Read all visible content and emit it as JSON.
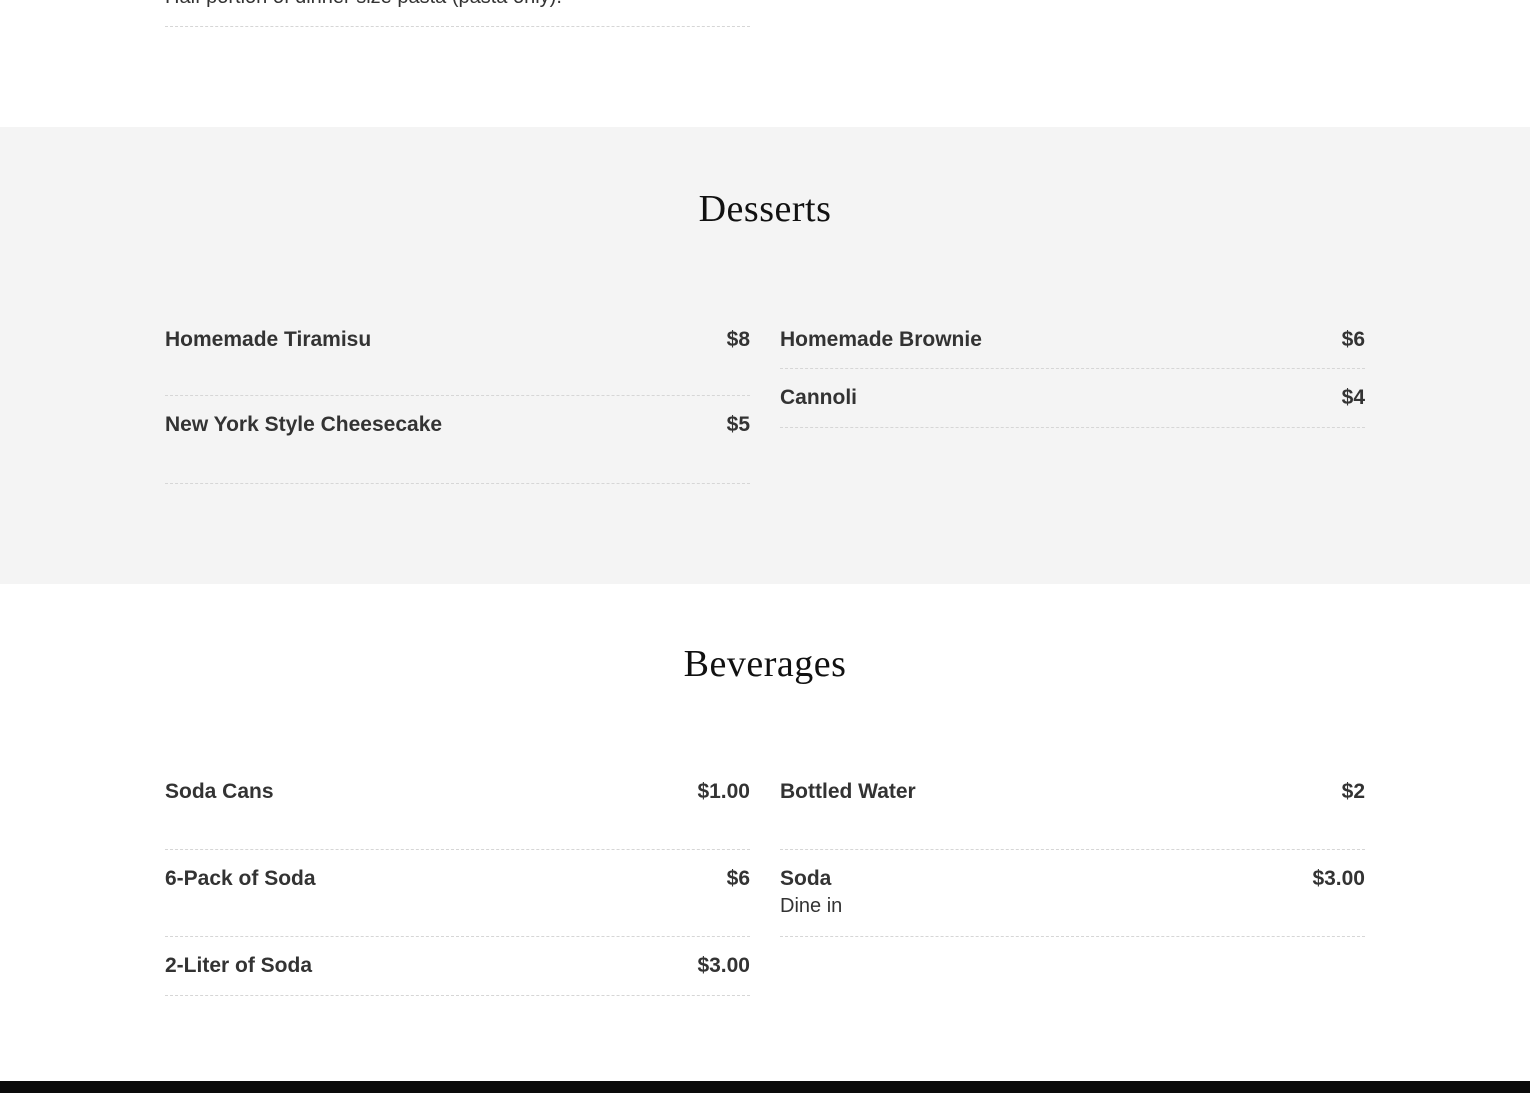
{
  "top": {
    "partial_description": "Half portion of dinner size pasta (pasta only)."
  },
  "desserts": {
    "title": "Desserts",
    "left": [
      {
        "name": "Homemade Tiramisu",
        "price": "$8"
      },
      {
        "name": "New York Style Cheesecake",
        "price": "$5"
      }
    ],
    "right": [
      {
        "name": "Homemade Brownie",
        "price": "$6"
      },
      {
        "name": "Cannoli",
        "price": "$4"
      }
    ]
  },
  "beverages": {
    "title": "Beverages",
    "left": [
      {
        "name": "Soda Cans",
        "price": "$1.00"
      },
      {
        "name": "6-Pack of Soda",
        "price": "$6"
      },
      {
        "name": "2-Liter of Soda",
        "price": "$3.00"
      }
    ],
    "right": [
      {
        "name": "Bottled Water",
        "price": "$2"
      },
      {
        "name": "Soda",
        "price": "$3.00",
        "description": "Dine in"
      }
    ]
  },
  "colors": {
    "section_alt_background": "#f4f4f4",
    "text": "#333333",
    "heading": "#111111",
    "divider": "#d6d6d6",
    "footer": "#0b0b0b"
  }
}
